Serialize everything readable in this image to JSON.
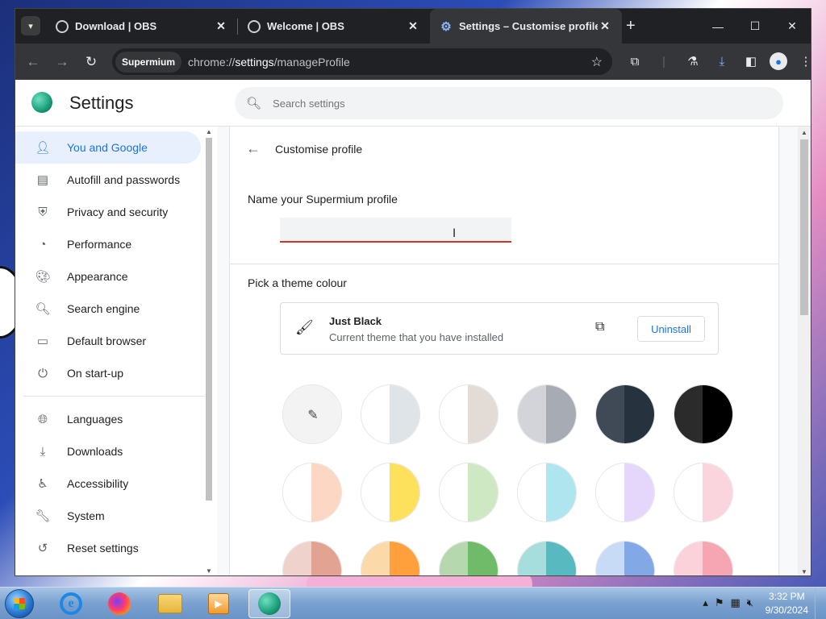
{
  "browser": {
    "tabs": [
      {
        "title": "Download | OBS",
        "active": false,
        "icon": "obs-icon"
      },
      {
        "title": "Welcome | OBS",
        "active": false,
        "icon": "obs-icon"
      },
      {
        "title": "Settings – Customise profile",
        "active": true,
        "icon": "gear-icon"
      }
    ],
    "omnibox": {
      "chip": "Supermium",
      "url_scheme": "chrome://",
      "url_host": "settings",
      "url_path": "/manageProfile"
    }
  },
  "settings": {
    "title": "Settings",
    "search_placeholder": "Search settings",
    "sidebar": {
      "items": [
        {
          "label": "You and Google",
          "icon": "person-icon",
          "active": true
        },
        {
          "label": "Autofill and passwords",
          "icon": "clipboard-icon"
        },
        {
          "label": "Privacy and security",
          "icon": "shield-icon"
        },
        {
          "label": "Performance",
          "icon": "speedometer-icon"
        },
        {
          "label": "Appearance",
          "icon": "palette-icon"
        },
        {
          "label": "Search engine",
          "icon": "search-icon"
        },
        {
          "label": "Default browser",
          "icon": "browser-icon"
        },
        {
          "label": "On start-up",
          "icon": "power-icon"
        }
      ],
      "items2": [
        {
          "label": "Languages",
          "icon": "globe-icon"
        },
        {
          "label": "Downloads",
          "icon": "download-icon"
        },
        {
          "label": "Accessibility",
          "icon": "accessibility-icon"
        },
        {
          "label": "System",
          "icon": "wrench-icon"
        },
        {
          "label": "Reset settings",
          "icon": "reset-icon"
        }
      ]
    },
    "page": {
      "title": "Customise profile",
      "name_label": "Name your Supermium profile",
      "name_value": "",
      "theme_label": "Pick a theme colour",
      "current_theme": {
        "name": "Just Black",
        "description": "Current theme that you have installed",
        "uninstall_label": "Uninstall"
      },
      "swatches": [
        {
          "left": "#f3f3f3",
          "right": "#f3f3f3",
          "picker": true
        },
        {
          "left": "#ffffff",
          "right": "#dfe4e8"
        },
        {
          "left": "#ffffff",
          "right": "#e3dcd6"
        },
        {
          "left": "#d3d4da",
          "right": "#a7abb3"
        },
        {
          "left": "#3f4a56",
          "right": "#26323d"
        },
        {
          "left": "#2b2b2b",
          "right": "#000000"
        },
        {
          "left": "#ffffff",
          "right": "#fbd7c4"
        },
        {
          "left": "#ffffff",
          "right": "#fde05c"
        },
        {
          "left": "#ffffff",
          "right": "#cfe8c4"
        },
        {
          "left": "#ffffff",
          "right": "#aee5ef"
        },
        {
          "left": "#ffffff",
          "right": "#e5d7fb"
        },
        {
          "left": "#ffffff",
          "right": "#fad5de"
        },
        {
          "left": "#efd2cb",
          "right": "#e2a392"
        },
        {
          "left": "#fcd9a9",
          "right": "#ffa03c"
        },
        {
          "left": "#b5d8ae",
          "right": "#6fbb6a"
        },
        {
          "left": "#a6dede",
          "right": "#58b9c0"
        },
        {
          "left": "#c7dbf6",
          "right": "#82a9e5"
        },
        {
          "left": "#fbd2d9",
          "right": "#f6a6b3"
        }
      ]
    }
  },
  "taskbar": {
    "time": "3:32 PM",
    "date": "9/30/2024"
  }
}
